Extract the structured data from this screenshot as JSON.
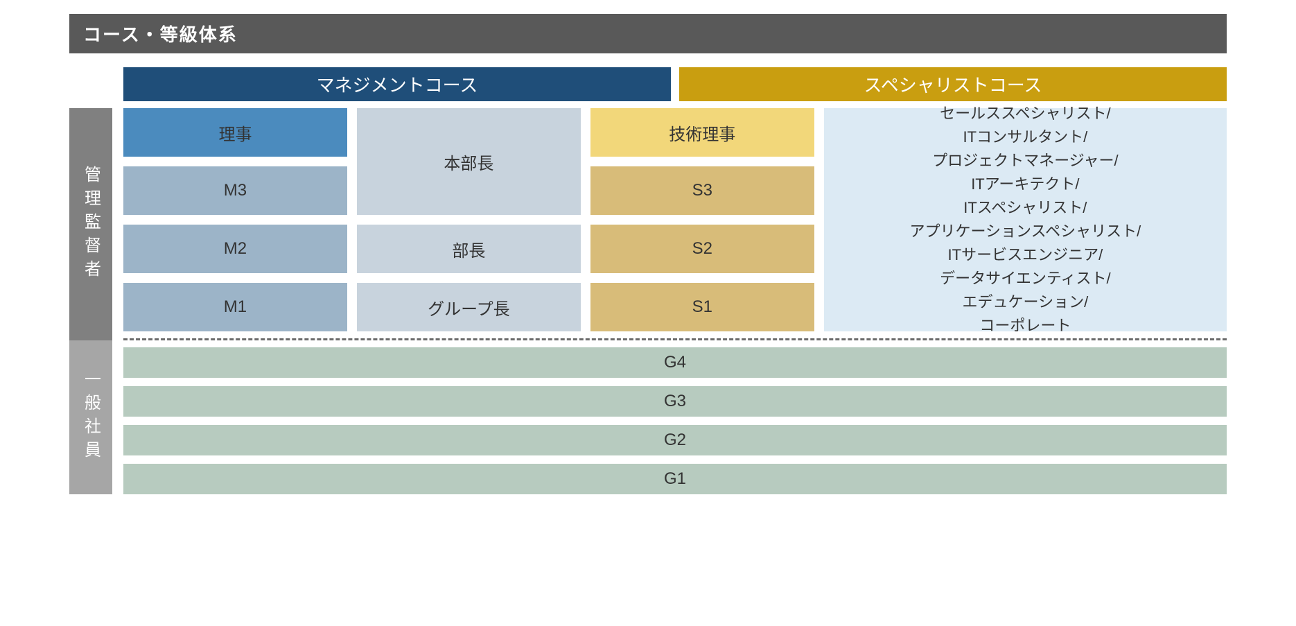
{
  "title": "コース・等級体系",
  "courses": {
    "management": "マネジメントコース",
    "specialist": "スペシャリストコース"
  },
  "sideLabels": {
    "supervisor": "管理監督者",
    "general": "一般社員"
  },
  "supervisor": {
    "mgmt_levels_top": "理事",
    "mgmt_levels": [
      "M3",
      "M2",
      "M1"
    ],
    "mgmt_roles_top": "本部長",
    "mgmt_roles": [
      "部長",
      "グループ長"
    ],
    "spec_levels_top": "技術理事",
    "spec_levels": [
      "S3",
      "S2",
      "S1"
    ],
    "spec_roles": [
      "セールススペシャリスト/",
      "ITコンサルタント/",
      "プロジェクトマネージャー/",
      "ITアーキテクト/",
      "ITスペシャリスト/",
      "アプリケーションスペシャリスト/",
      "ITサービスエンジニア/",
      "データサイエンティスト/",
      "エデュケーション/",
      "コーポレート"
    ]
  },
  "general_levels": [
    "G4",
    "G3",
    "G2",
    "G1"
  ]
}
